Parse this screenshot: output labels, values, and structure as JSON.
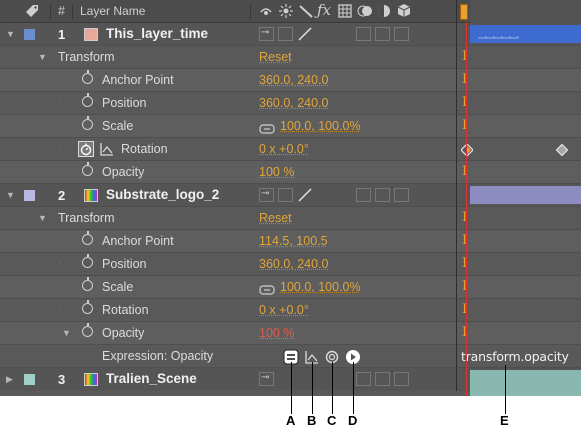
{
  "header": {
    "hash_label": "#",
    "layer_name_label": "Layer Name",
    "switch_icons": [
      "shy-icon",
      "collapse-icon",
      "quality-icon",
      "fx-icon",
      "frame-blend-icon",
      "motion-blur-icon",
      "adjustment-icon",
      "3d-layer-icon"
    ]
  },
  "layers": [
    {
      "number": "1",
      "name": "This_layer_time",
      "label_color": "#6a8fd0",
      "swatch_color": "#e8a898"
    },
    {
      "number": "2",
      "name": "Substrate_logo_2",
      "label_color": "#b8b8e0",
      "swatch_color": "gradient"
    },
    {
      "number": "3",
      "name": "Tralien_Scene",
      "label_color": "#9fd0c8",
      "swatch_color": "gradient"
    }
  ],
  "layer1": {
    "transform_label": "Transform",
    "transform_reset": "Reset",
    "properties": [
      {
        "name": "Anchor Point",
        "value": "360.0, 240.0"
      },
      {
        "name": "Position",
        "value": "360.0, 240.0"
      },
      {
        "name": "Scale",
        "value": "100.0, 100.0%"
      },
      {
        "name": "Rotation",
        "value": "0 x +0.0°"
      },
      {
        "name": "Opacity",
        "value": "100 %"
      }
    ]
  },
  "layer2": {
    "transform_label": "Transform",
    "transform_reset": "Reset",
    "properties": [
      {
        "name": "Anchor Point",
        "value": "114.5, 100.5"
      },
      {
        "name": "Position",
        "value": "360.0, 240.0"
      },
      {
        "name": "Scale",
        "value": "100.0, 100.0%"
      },
      {
        "name": "Rotation",
        "value": "0 x +0.0°"
      },
      {
        "name": "Opacity",
        "value": "100 %"
      }
    ],
    "expression_label": "Expression: Opacity",
    "expression_text": "transform.opacity"
  },
  "callouts": {
    "a": "A",
    "b": "B",
    "c": "C",
    "d": "D",
    "e": "E"
  },
  "colors": {
    "panel_bg": "#5a5a5a",
    "value_orange": "#e0a53a",
    "value_red": "#e05a4a",
    "timeline_layer1_bar": "#3d6bd0",
    "timeline_layer2_bar": "#8c8cc0",
    "timeline_layer3_bar": "#88b8b0",
    "current_time_indicator": "#e03030"
  }
}
